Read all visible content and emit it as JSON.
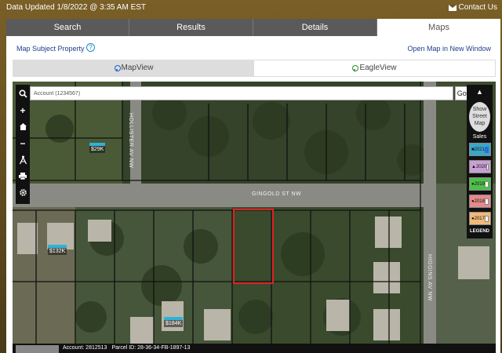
{
  "header": {
    "updated_text": "Data Updated 1/8/2022 @ 3:35 AM EST",
    "contact_label": "Contact Us"
  },
  "tabs": [
    {
      "label": "Search",
      "active": false
    },
    {
      "label": "Results",
      "active": false
    },
    {
      "label": "Details",
      "active": false
    },
    {
      "label": "Maps",
      "active": true
    }
  ],
  "links": {
    "map_subject": "Map Subject Property",
    "help": "?",
    "open_new": "Open Map in New Window"
  },
  "view_tabs": [
    {
      "label": "MapView",
      "active": true,
      "icon": "map-pin-icon"
    },
    {
      "label": "EagleView",
      "active": false,
      "icon": "map-pin-icon"
    }
  ],
  "map": {
    "search_value": "Account (1234567)",
    "go_label": "Go!",
    "tools": [
      "search-icon",
      "zoom-in-icon",
      "home-icon",
      "zoom-out-icon",
      "measure-icon",
      "print-icon",
      "settings-icon"
    ],
    "legend": {
      "collapse": "▲",
      "street_map": "Show Street Map",
      "sales_label": "Sales",
      "title": "LEGEND",
      "years": [
        {
          "year": "2021",
          "color": "#3aa6c9",
          "marker": "■",
          "checked": true
        },
        {
          "year": "2020",
          "color": "#c9a0d6",
          "marker": "▲",
          "checked": false
        },
        {
          "year": "2019",
          "color": "#4fbf4a",
          "marker": "●",
          "checked": false
        },
        {
          "year": "2018",
          "color": "#e88a8a",
          "marker": "●",
          "checked": false
        },
        {
          "year": "2017",
          "color": "#f2b97a",
          "marker": "●",
          "checked": false
        }
      ]
    },
    "prices": [
      "$29K",
      "$132K",
      "$184K"
    ],
    "roads": [
      "GINGOLD ST NW",
      "HOLLISTER AV NW",
      "HIGGINS AV NW"
    ],
    "footer": {
      "account": "Account: 2812513",
      "parcel": "Parcel ID: 28-36-34-FB-1897-13"
    }
  }
}
